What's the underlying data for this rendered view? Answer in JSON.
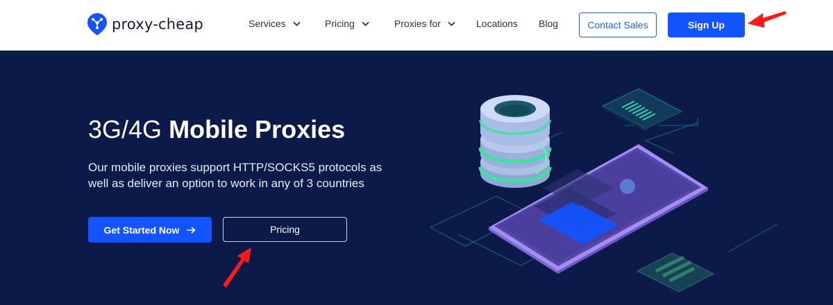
{
  "nav": {
    "logo_text": "proxy-cheap",
    "items": [
      {
        "label": "Services",
        "has_dropdown": true
      },
      {
        "label": "Pricing",
        "has_dropdown": true
      },
      {
        "label": "Proxies for",
        "has_dropdown": true
      },
      {
        "label": "Locations",
        "has_dropdown": false
      },
      {
        "label": "Blog",
        "has_dropdown": false
      }
    ],
    "contact_label": "Contact Sales",
    "signup_label": "Sign Up"
  },
  "hero": {
    "title_light": "3G/4G ",
    "title_bold": "Mobile Proxies",
    "description": "Our mobile proxies support HTTP/SOCKS5 protocols as well as deliver an option to work in any of 3 countries",
    "start_label": "Get Started Now",
    "pricing_label": "Pricing"
  },
  "colors": {
    "accent": "#1254ff",
    "hero_bg": "#0c1a4a",
    "annotation": "#ff1a1a"
  },
  "icons": {
    "logo": "location-pin-icon",
    "dropdown": "chevron-down-icon",
    "arrow": "arrow-right-icon"
  }
}
